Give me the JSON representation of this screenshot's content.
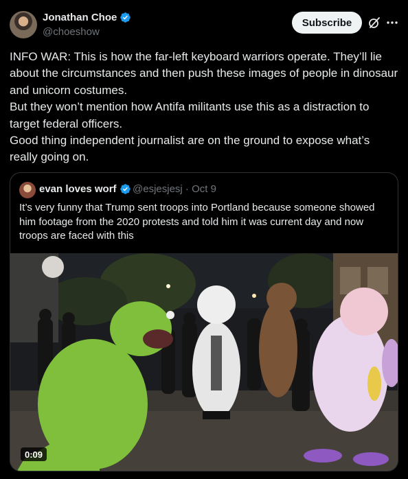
{
  "author": {
    "display_name": "Jonathan Choe",
    "handle": "@choeshow"
  },
  "actions": {
    "subscribe_label": "Subscribe"
  },
  "icons": {
    "verified": "verified-badge-icon",
    "grok": "grok-icon",
    "more": "more-options-icon"
  },
  "colors": {
    "verified": "#1d9bf0",
    "background": "#000000",
    "text": "#e7e9ea",
    "muted": "#71767b"
  },
  "post": {
    "text": "INFO WAR: This is how the far-left keyboard warriors operate. They’ll lie about the circumstances and then push these images of people in dinosaur and unicorn costumes.\nBut they won’t mention how Antifa militants use this as a distraction to target federal officers.\nGood thing independent journalist are on the ground to expose what’s really going on."
  },
  "quoted": {
    "display_name": "evan loves worf",
    "handle_date": "@esjesjesj · Oct 9",
    "text": "It’s very funny that Trump sent troops into Portland because someone showed him footage from the 2020 protests and told him it was current day and now troops are faced with this",
    "video_duration": "0:09"
  }
}
